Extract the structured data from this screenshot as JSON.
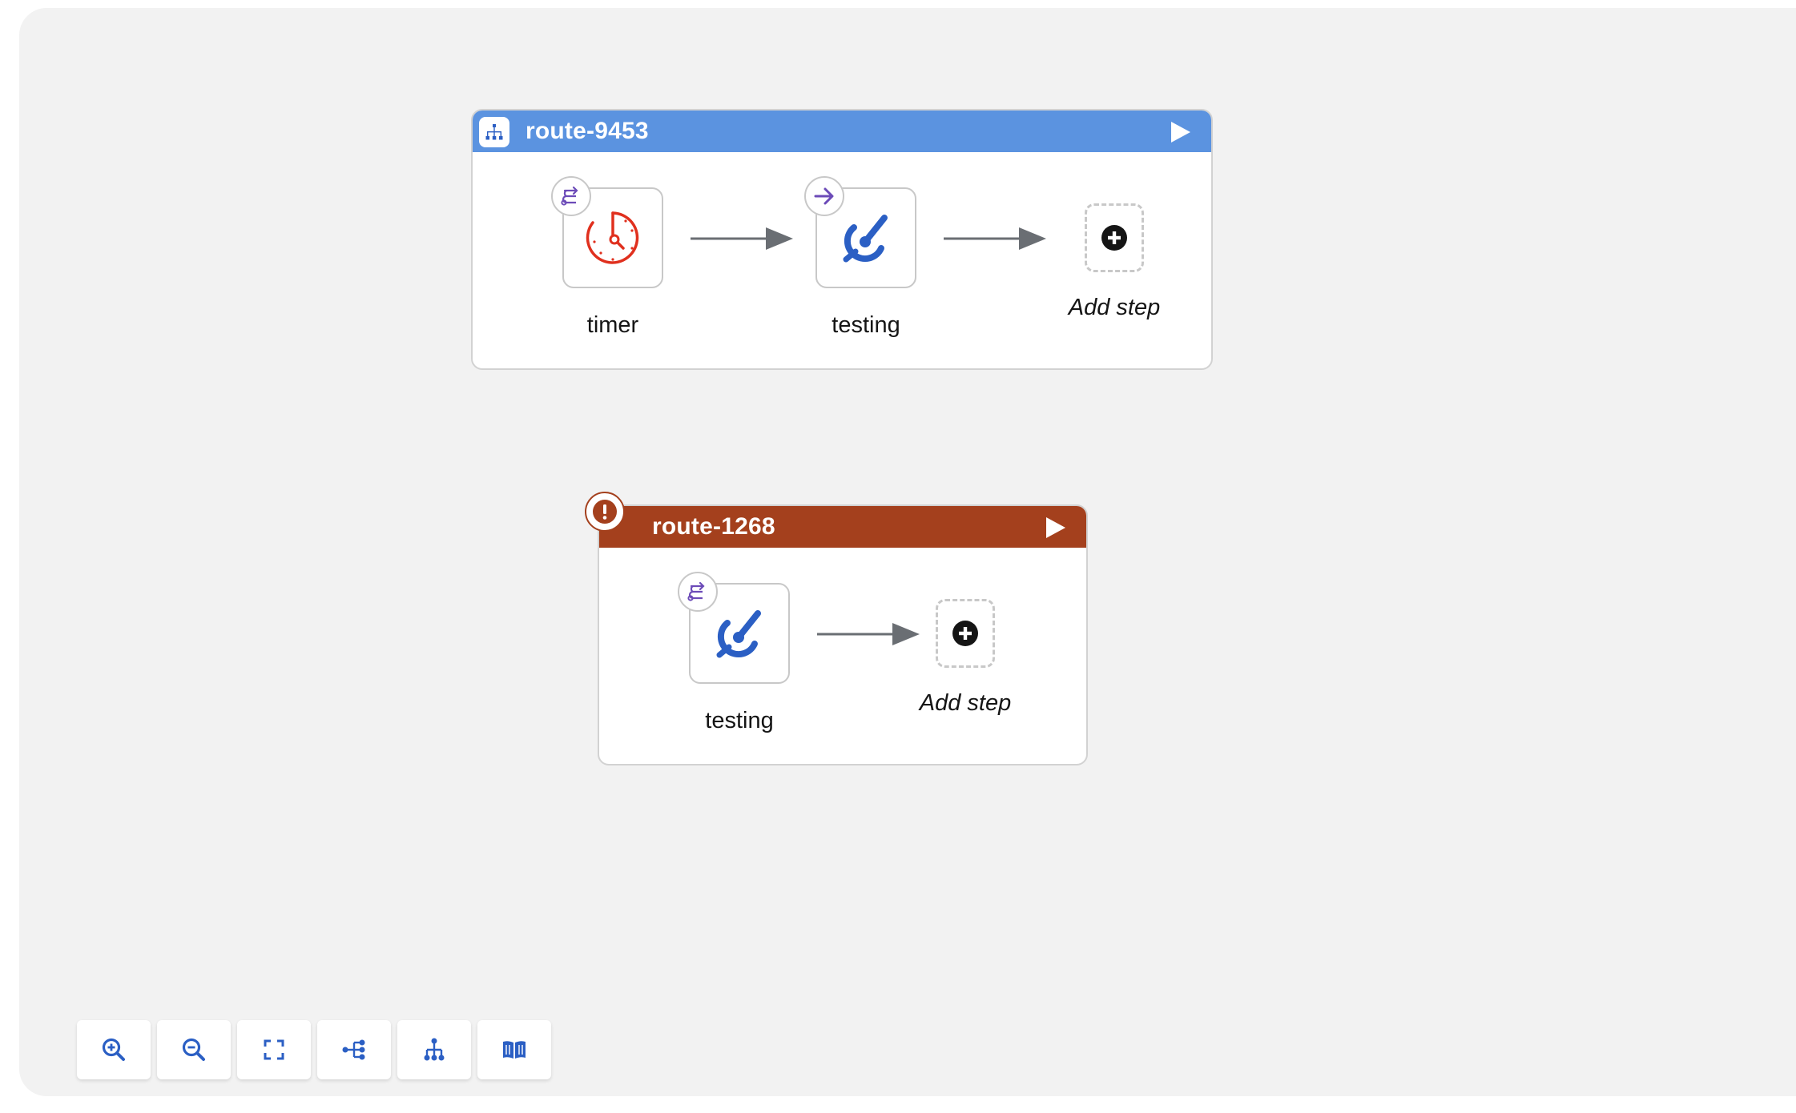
{
  "colors": {
    "canvas": "#f2f2f2",
    "route_ok_header": "#5b93e0",
    "route_error_header": "#a4401d",
    "edge": "#6a6e73",
    "link_blue": "#2b5fc4",
    "timer_red": "#e0301e",
    "badge_purple": "#6c4bb8"
  },
  "routes": [
    {
      "title": "route-9453",
      "status": "ok",
      "header_icon": "route-hierarchy-icon",
      "play_icon": "play-icon",
      "steps": [
        {
          "label": "timer",
          "icon": "timer-icon",
          "badge": "from-consumer-icon"
        },
        {
          "label": "testing",
          "icon": "log-endpoint-icon",
          "badge": "to-arrow-icon"
        }
      ],
      "add_step": {
        "label": "Add step",
        "icon": "plus-circle-icon"
      }
    },
    {
      "title": "route-1268",
      "status": "error",
      "header_icon": "error-exclamation-icon",
      "play_icon": "play-icon",
      "steps": [
        {
          "label": "testing",
          "icon": "log-endpoint-icon",
          "badge": "from-consumer-icon"
        }
      ],
      "add_step": {
        "label": "Add step",
        "icon": "plus-circle-icon"
      }
    }
  ],
  "toolbar": {
    "buttons": [
      {
        "name": "zoom-in",
        "icon": "zoom-in-icon"
      },
      {
        "name": "zoom-out",
        "icon": "zoom-out-icon"
      },
      {
        "name": "fit-to-screen",
        "icon": "expand-icon"
      },
      {
        "name": "horizontal-layout",
        "icon": "horizontal-layout-icon"
      },
      {
        "name": "vertical-layout",
        "icon": "vertical-layout-icon"
      },
      {
        "name": "legend",
        "icon": "book-icon"
      }
    ]
  }
}
